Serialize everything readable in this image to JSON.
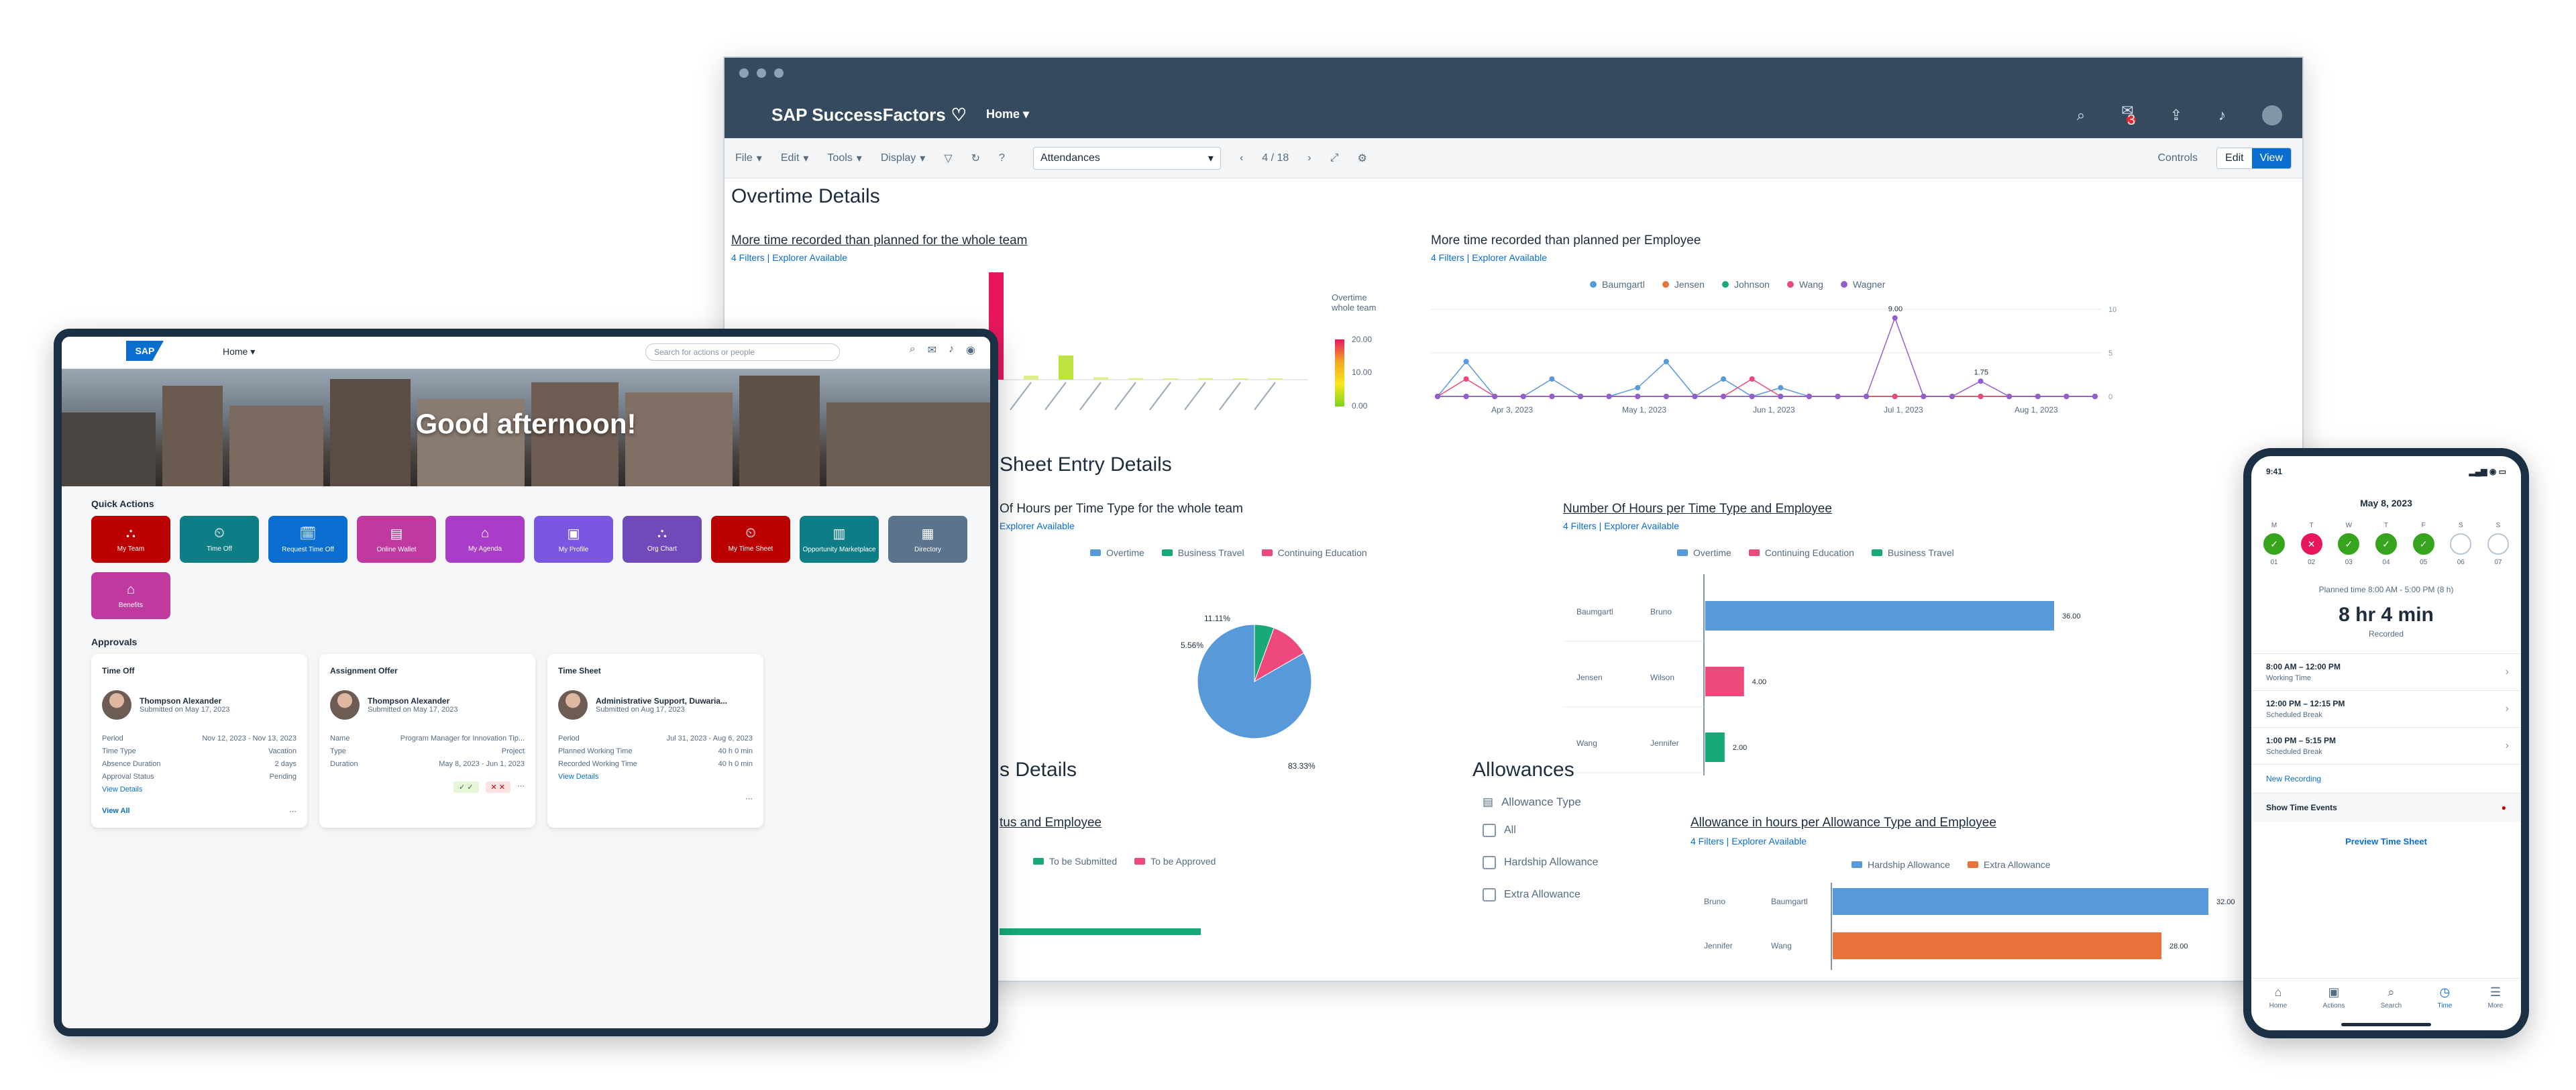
{
  "desktop": {
    "brand": "SAP SuccessFactors",
    "home_menu": "Home ▾",
    "notif_count": "3",
    "toolbar": {
      "menus": [
        "File",
        "Edit",
        "Tools",
        "Display"
      ],
      "story_select": "Attendances",
      "page_nav": "4 / 18",
      "controls_label": "Controls",
      "edit_label": "Edit",
      "view_label": "View"
    },
    "overtime": {
      "title": "Overtime Details",
      "team_chart_title": "More time recorded than planned for the whole team",
      "team_chart_sub": "4 Filters | Explorer Available",
      "emp_chart_title": "More time recorded than planned per Employee",
      "emp_chart_sub": "4 Filters | Explorer Available",
      "heat_legend_title": "Overtime whole team",
      "heat_ticks": [
        "20.00",
        "10.00",
        "0.00"
      ],
      "emp_legend": [
        "Baumgartl",
        "Jensen",
        "Johnson",
        "Wang",
        "Wagner"
      ],
      "emp_dates": [
        "Apr 3, 2023",
        "May 1, 2023",
        "Jun 1, 2023",
        "Jul 1, 2023",
        "Aug 1, 2023"
      ],
      "emp_labels": [
        "9.00",
        "1.75"
      ],
      "emp_y": [
        "10",
        "5",
        "0"
      ]
    },
    "timesheet": {
      "title": "Sheet Entry Details",
      "pie_title": "Of Hours per Time Type for the whole team",
      "pie_sub": "Explorer Available",
      "pie_legend": [
        "Overtime",
        "Business Travel",
        "Continuing Education"
      ],
      "bar_title": "Number Of Hours per Time Type and Employee",
      "bar_sub": "4 Filters | Explorer Available",
      "bar_legend": [
        "Overtime",
        "Continuing Education",
        "Business Travel"
      ],
      "bar_rows": [
        [
          "Baumgartl",
          "Bruno"
        ],
        [
          "Jensen",
          "Wilson"
        ],
        [
          "Wang",
          "Jennifer"
        ]
      ]
    },
    "status": {
      "title": "s Details",
      "chart_title": "tus and Employee",
      "legend": [
        "To be Submitted",
        "To be Approved"
      ]
    },
    "allowances": {
      "title": "Allowances",
      "filter_title": "Allowance Type",
      "items": [
        "All",
        "Hardship Allowance",
        "Extra Allowance"
      ],
      "chart_title": "Allowance in hours per Allowance Type and Employee",
      "chart_sub": "4 Filters | Explorer Available",
      "legend": [
        "Hardship Allowance",
        "Extra Allowance"
      ],
      "rows": [
        [
          "Bruno",
          "Baumgartl"
        ],
        [
          "Jennifer",
          "Wang"
        ]
      ]
    }
  },
  "chart_data": [
    {
      "type": "bar",
      "title": "More time recorded than planned for the whole team",
      "series": [
        {
          "name": "Overtime",
          "values": [
            0.2,
            0.3,
            6,
            3,
            2,
            0.3,
            0.4,
            14,
            0.5,
            3,
            0.3,
            0.2,
            0.1,
            0.2,
            0.1,
            0.1
          ]
        }
      ],
      "color_scale": "heatmap",
      "ylim": [
        0,
        20
      ]
    },
    {
      "type": "line",
      "title": "More time recorded than planned per Employee",
      "series": [
        {
          "name": "Baumgartl",
          "values": [
            0,
            4,
            0,
            0,
            2,
            0,
            0,
            1,
            4,
            0,
            2,
            0,
            1,
            0,
            0,
            0,
            0,
            0,
            0,
            0,
            0,
            0,
            0,
            0
          ]
        },
        {
          "name": "Jensen",
          "values": [
            0,
            0,
            0,
            0,
            0,
            0,
            0,
            0,
            0,
            0,
            0,
            0,
            0,
            0,
            0,
            0,
            0,
            0,
            0,
            0,
            0,
            0,
            0,
            0
          ]
        },
        {
          "name": "Johnson",
          "values": [
            0,
            0,
            0,
            0,
            0,
            0,
            0,
            0,
            0,
            0,
            0,
            0,
            0,
            0,
            0,
            0,
            0,
            0,
            0,
            0,
            0,
            0,
            0,
            0
          ]
        },
        {
          "name": "Wang",
          "values": [
            0,
            2,
            0,
            0,
            0,
            0,
            0,
            0,
            0,
            0,
            0,
            2,
            0,
            0,
            0,
            0,
            0,
            0,
            0,
            0,
            0,
            0,
            0,
            0
          ]
        },
        {
          "name": "Wagner",
          "values": [
            0,
            0,
            0,
            0,
            0,
            0,
            0,
            0,
            0,
            0,
            0,
            0,
            0,
            0,
            0,
            0,
            9,
            0,
            0,
            1.75,
            0,
            0,
            0,
            0
          ]
        }
      ],
      "ylim": [
        0,
        10
      ]
    },
    {
      "type": "pie",
      "title": "Of Hours per Time Type for the whole team",
      "slices": [
        {
          "name": "Overtime",
          "value": 83.33
        },
        {
          "name": "Business Travel",
          "value": 5.56
        },
        {
          "name": "Continuing Education",
          "value": 11.11
        }
      ],
      "labels": [
        "83.33%",
        "5.56%",
        "11.11%"
      ]
    },
    {
      "type": "bar",
      "title": "Number Of Hours per Time Type and Employee",
      "categories": [
        "Baumgartl Bruno",
        "Jensen Wilson",
        "Wang Jennifer"
      ],
      "series": [
        {
          "name": "Overtime",
          "values": [
            36,
            0,
            0
          ]
        },
        {
          "name": "Continuing Education",
          "values": [
            0,
            4,
            0
          ]
        },
        {
          "name": "Business Travel",
          "values": [
            0,
            0,
            2
          ]
        }
      ],
      "value_labels": [
        "36.00",
        "4.00",
        "2.00"
      ]
    },
    {
      "type": "bar",
      "title": "Allowance in hours per Allowance Type and Employee",
      "categories": [
        "Bruno Baumgartl",
        "Jennifer Wang"
      ],
      "series": [
        {
          "name": "Hardship Allowance",
          "values": [
            32,
            0
          ]
        },
        {
          "name": "Extra Allowance",
          "values": [
            0,
            28
          ]
        }
      ],
      "value_labels": [
        "32.00",
        "28.00"
      ]
    }
  ],
  "tablet": {
    "home": "Home ▾",
    "search_placeholder": "Search for actions or people",
    "greeting": "Good afternoon!",
    "quick_actions_title": "Quick Actions",
    "quick_actions": [
      {
        "label": "My Team",
        "color": "#bb0000",
        "icon": "⛬"
      },
      {
        "label": "Time Off",
        "color": "#0f7d86",
        "icon": "⏲"
      },
      {
        "label": "Request Time Off",
        "color": "#0a6ed1",
        "icon": "🗓"
      },
      {
        "label": "Online Wallet",
        "color": "#c0399f",
        "icon": "▤"
      },
      {
        "label": "My Agenda",
        "color": "#a93cc9",
        "icon": "⌂"
      },
      {
        "label": "My Profile",
        "color": "#7b56e0",
        "icon": "▣"
      },
      {
        "label": "Org Chart",
        "color": "#6f4ab8",
        "icon": "⛬"
      },
      {
        "label": "My Time Sheet",
        "color": "#bb0000",
        "icon": "⏲"
      },
      {
        "label": "Opportunity Marketplace",
        "color": "#0f7d86",
        "icon": "▥"
      },
      {
        "label": "Directory",
        "color": "#5b738b",
        "icon": "▦"
      },
      {
        "label": "Benefits",
        "color": "#c0399f",
        "icon": "⌂"
      }
    ],
    "approvals_title": "Approvals",
    "cards": [
      {
        "title": "Time Off",
        "name": "Thompson Alexander",
        "sub": "Submitted on May 17, 2023",
        "rows": [
          [
            "Period",
            "Nov 12, 2023 - Nov 13, 2023"
          ],
          [
            "Time Type",
            "Vacation"
          ],
          [
            "Absence Duration",
            "2 days"
          ],
          [
            "Approval Status",
            "Pending"
          ]
        ],
        "link": "View Details",
        "foot": "View All"
      },
      {
        "title": "Assignment Offer",
        "name": "Thompson Alexander",
        "sub": "Submitted on May 17, 2023",
        "rows": [
          [
            "Name",
            "Program Manager for Innovation Tip..."
          ],
          [
            "Type",
            "Project"
          ],
          [
            "Duration",
            "May 8, 2023 - Jun 1, 2023"
          ]
        ],
        "link": "",
        "foot": "Approve  Decline"
      },
      {
        "title": "Time Sheet",
        "name": "Administrative Support, Duwaria...",
        "sub": "Submitted on Aug 17, 2023",
        "rows": [
          [
            "Period",
            "Jul 31, 2023 - Aug 6, 2023"
          ],
          [
            "Planned Working Time",
            "40 h 0 min"
          ],
          [
            "Recorded Working Time",
            "40 h 0 min"
          ]
        ],
        "link": "View Details",
        "foot": ""
      }
    ]
  },
  "phone": {
    "time": "9:41",
    "signal": "▂▄▆ ◉ ▭",
    "date": "May 8, 2023",
    "week": [
      {
        "d": "M",
        "n": "01",
        "state": "ok"
      },
      {
        "d": "T",
        "n": "02",
        "state": "err"
      },
      {
        "d": "W",
        "n": "03",
        "state": "ok"
      },
      {
        "d": "T",
        "n": "04",
        "state": "ok"
      },
      {
        "d": "F",
        "n": "05",
        "state": "ok"
      },
      {
        "d": "S",
        "n": "06",
        "state": "none"
      },
      {
        "d": "S",
        "n": "07",
        "state": "none"
      }
    ],
    "planned": "Planned time 8:00 AM - 5:00 PM (8 h)",
    "duration": "8 hr 4 min",
    "rounded": "Recorded",
    "entries": [
      {
        "time": "8:00 AM – 12:00 PM",
        "type": "Working Time"
      },
      {
        "time": "12:00 PM – 12:15 PM",
        "type": "Scheduled Break"
      },
      {
        "time": "1:00 PM – 5:15 PM",
        "type": "Scheduled Break"
      }
    ],
    "new_recording": "New Recording",
    "show_time_events": "Show Time Events",
    "preview": "Preview Time Sheet",
    "tabs": [
      "Home",
      "Actions",
      "Search",
      "Time",
      "More"
    ]
  }
}
